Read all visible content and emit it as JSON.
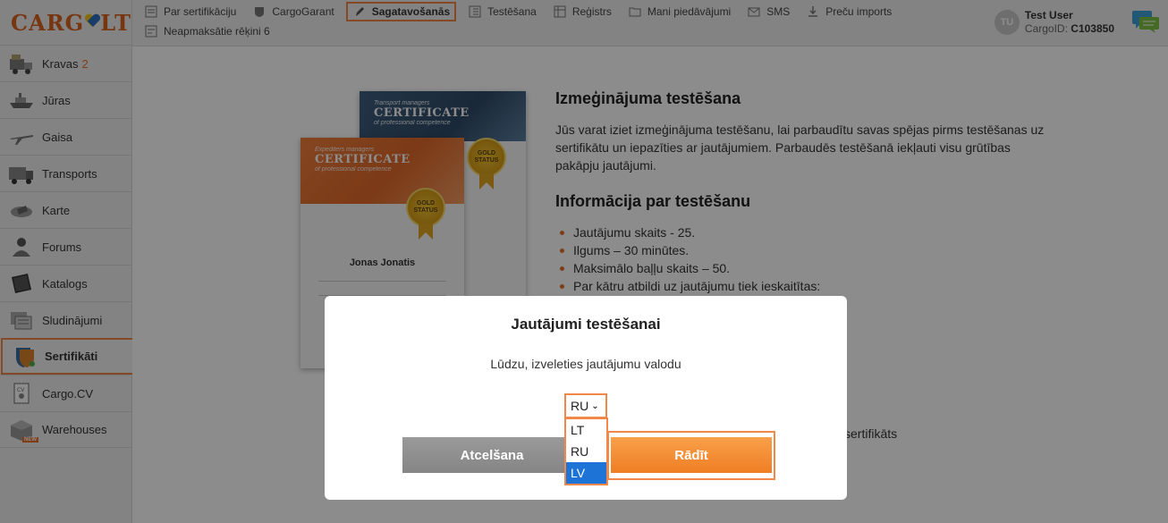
{
  "sidebar": {
    "logo": "CARG",
    "logo_tail": "LT",
    "items": [
      {
        "label": "Kravas",
        "count": "2",
        "icon": "truck-cargo-icon"
      },
      {
        "label": "Jūras",
        "icon": "ship-icon"
      },
      {
        "label": "Gaisa",
        "icon": "airplane-icon"
      },
      {
        "label": "Transports",
        "icon": "truck-icon"
      },
      {
        "label": "Karte",
        "icon": "map-icon"
      },
      {
        "label": "Forums",
        "icon": "forum-people-icon"
      },
      {
        "label": "Katalogs",
        "icon": "catalog-book-icon"
      },
      {
        "label": "Sludinājumi",
        "icon": "ads-icon"
      },
      {
        "label": "Sertifikāti",
        "icon": "shield-certificate-icon",
        "active": true
      },
      {
        "label": "Cargo.CV",
        "icon": "cv-document-icon"
      },
      {
        "label": "Warehouses",
        "icon": "warehouse-box-icon",
        "badge": "NEW"
      }
    ]
  },
  "topbar": {
    "links": [
      {
        "label": "Par sertifikāciju",
        "icon": "info-page-icon"
      },
      {
        "label": "CargoGarant",
        "icon": "shield-icon"
      },
      {
        "label": "Sagatavošanās",
        "icon": "pencil-icon",
        "active": true
      },
      {
        "label": "Testēšana",
        "icon": "checklist-icon"
      },
      {
        "label": "Reģistrs",
        "icon": "registry-icon"
      },
      {
        "label": "Mani piedāvājumi",
        "icon": "folder-icon"
      },
      {
        "label": "SMS",
        "icon": "mail-icon"
      },
      {
        "label": "Preču imports",
        "icon": "download-icon"
      },
      {
        "label": "Neapmaksātie rēķini 6",
        "icon": "invoice-icon"
      }
    ],
    "user": {
      "initials": "TU",
      "name": "Test User",
      "id_label": "CargoID:",
      "id_value": "C103850"
    }
  },
  "certificates": {
    "back": {
      "small": "Transport managers",
      "big": "CERTIFICATE",
      "sub": "of professional competence",
      "seal1": "GOLD",
      "seal2": "STATUS"
    },
    "front": {
      "small": "Expediters managers",
      "big": "CERTIFICATE",
      "sub": "of professional competence",
      "seal1": "GOLD",
      "seal2": "STATUS",
      "person": "Jonas Jonatis"
    }
  },
  "info": {
    "heading1": "Izmeģinājuma testēšana",
    "paragraph": "Jūs varat iziet izmeģinājuma testēšanu, lai parbaudītu savas spējas pirms testēšanas uz sertifikātu un iepazīties ar jautājumiem. Parbaudēs testēšanā iekļauti visu grūtības pakāpju jautājumi.",
    "heading2": "Informācija par testēšanu",
    "items": [
      "Jautājumu skaits - 25.",
      "Ilgums – 30 minūtes.",
      "Maksimālo baļļu skaits – 50.",
      "Par kātru atbildi uz jautājumu tiek ieskaitītas:"
    ],
    "tail": "sertifikāts"
  },
  "modal": {
    "title": "Jautājumi testēšanai",
    "text": "Lūdzu, izveleties jautājumu valodu",
    "selected": "RU",
    "options": [
      "LT",
      "RU",
      "LV"
    ],
    "highlighted_option": "LV",
    "cancel_label": "Atcelšana",
    "show_label": "Rādīt"
  },
  "colors": {
    "accent": "#f0884a",
    "brand": "#d9611e",
    "highlight": "#1e73d6"
  }
}
